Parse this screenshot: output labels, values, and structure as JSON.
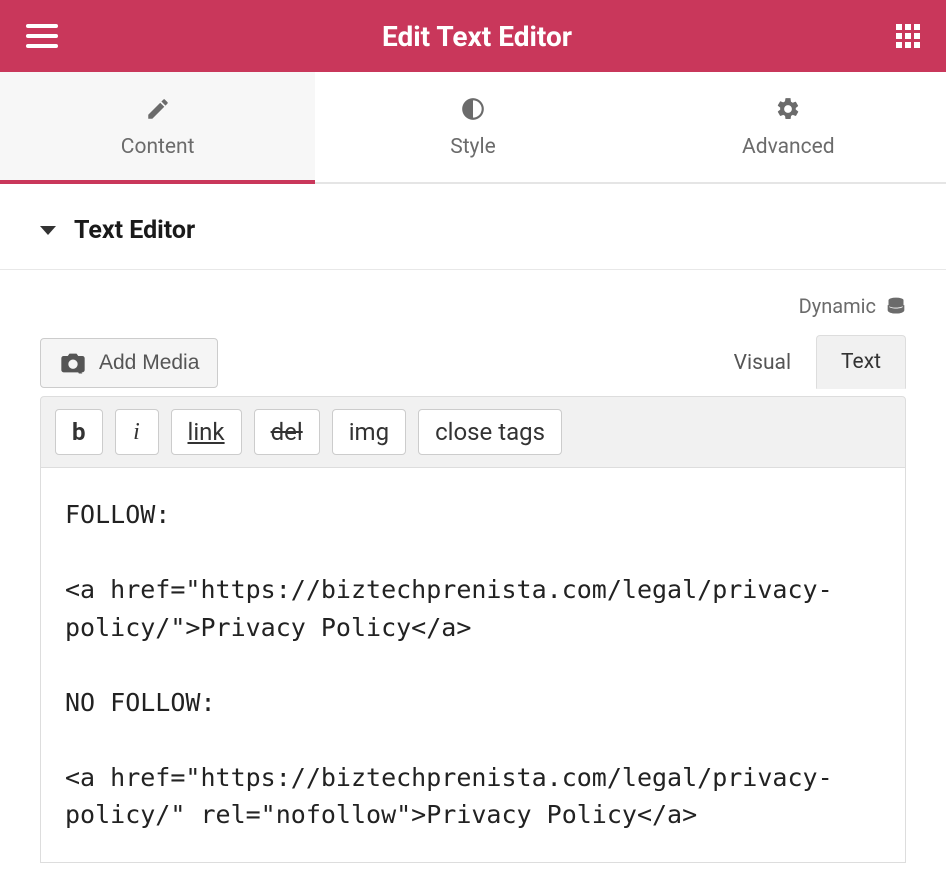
{
  "header": {
    "title": "Edit Text Editor"
  },
  "tabs": [
    {
      "label": "Content",
      "active": true
    },
    {
      "label": "Style",
      "active": false
    },
    {
      "label": "Advanced",
      "active": false
    }
  ],
  "section": {
    "title": "Text Editor"
  },
  "dynamic": {
    "label": "Dynamic"
  },
  "addMedia": {
    "label": "Add Media"
  },
  "editorModes": {
    "visual": "Visual",
    "text": "Text"
  },
  "toolbar": {
    "b": "b",
    "i": "i",
    "link": "link",
    "del": "del",
    "img": "img",
    "closeTags": "close tags"
  },
  "editorContent": "FOLLOW:\n\n<a href=\"https://biztechprenista.com/legal/privacy-policy/\">Privacy Policy</a>\n\nNO FOLLOW:\n\n<a href=\"https://biztechprenista.com/legal/privacy-policy/\" rel=\"nofollow\">Privacy Policy</a>"
}
